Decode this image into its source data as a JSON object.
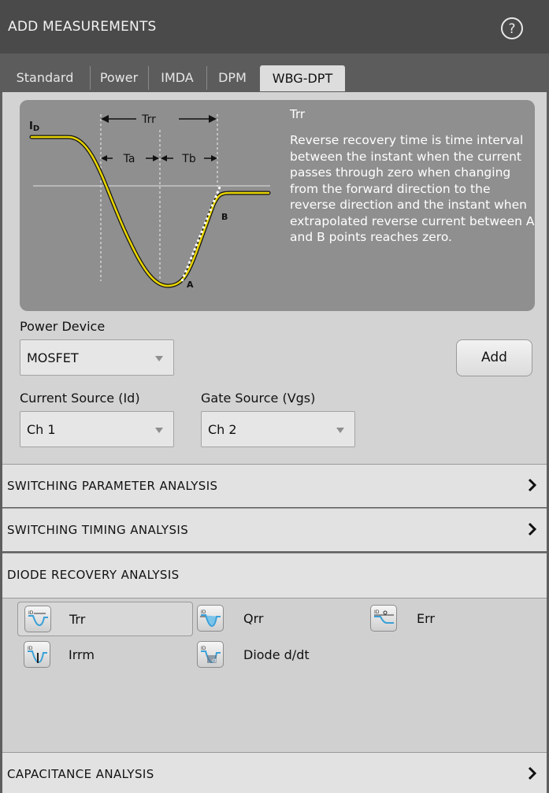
{
  "header": {
    "title": "ADD MEASUREMENTS",
    "help_icon": "question-circle-icon"
  },
  "tabs": [
    {
      "label": "Standard",
      "active": false
    },
    {
      "label": "Power",
      "active": false
    },
    {
      "label": "IMDA",
      "active": false
    },
    {
      "label": "DPM",
      "active": false
    },
    {
      "label": "WBG-DPT",
      "active": true
    }
  ],
  "diagram": {
    "labels": {
      "id": "ID",
      "trr": "Trr",
      "ta": "Ta",
      "tb": "Tb",
      "a": "A",
      "b": "B"
    },
    "colors": {
      "waveform": "#e8d400",
      "extrapolation": "#ffffff",
      "box": "#8f8f8f"
    }
  },
  "description": {
    "title": "Trr",
    "text": "Reverse recovery time is time interval between the instant when the current passes through zero when changing from the forward direction to the reverse direction and the instant when extrapolated reverse current between A and B points reaches zero."
  },
  "power_device": {
    "label": "Power Device",
    "value": "MOSFET"
  },
  "add_button": {
    "label": "Add"
  },
  "current_source": {
    "label": "Current Source (Id)",
    "value": "Ch 1"
  },
  "gate_source": {
    "label": "Gate Source (Vgs)",
    "value": "Ch 2"
  },
  "sections": {
    "switching_parameter": {
      "title": "SWITCHING PARAMETER ANALYSIS",
      "icon": "chevron-right-icon"
    },
    "switching_timing": {
      "title": "SWITCHING TIMING ANALYSIS",
      "icon": "chevron-right-icon"
    },
    "diode_recovery": {
      "title": "DIODE RECOVERY ANALYSIS"
    },
    "capacitance": {
      "title": "CAPACITANCE ANALYSIS",
      "icon": "chevron-right-icon"
    }
  },
  "measurements": [
    {
      "label": "Trr",
      "icon": "trr-icon",
      "selected": true
    },
    {
      "label": "Qrr",
      "icon": "qrr-icon",
      "selected": false
    },
    {
      "label": "Err",
      "icon": "err-icon",
      "selected": false
    },
    {
      "label": "Irrm",
      "icon": "irrm-icon",
      "selected": false
    },
    {
      "label": "Diode d/dt",
      "icon": "diode-dt-icon",
      "selected": false
    }
  ]
}
